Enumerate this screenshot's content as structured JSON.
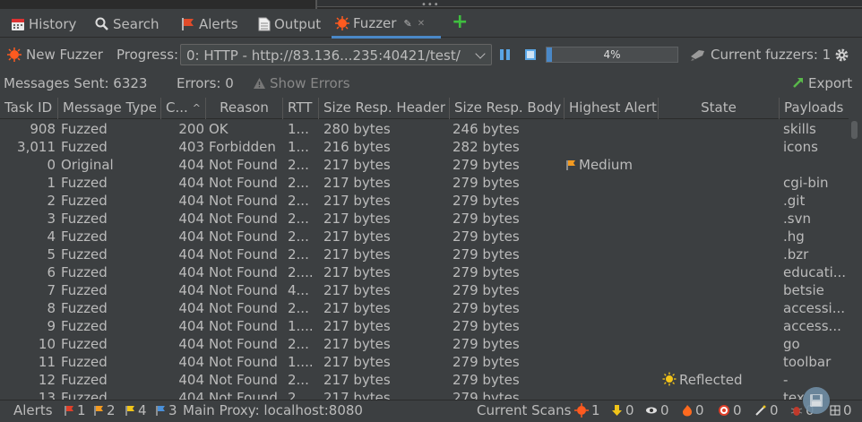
{
  "tabs": [
    {
      "label": "History",
      "icon": "history-icon"
    },
    {
      "label": "Search",
      "icon": "search-icon"
    },
    {
      "label": "Alerts",
      "icon": "alerts-flag-icon"
    },
    {
      "label": "Output",
      "icon": "output-document-icon"
    },
    {
      "label": "Fuzzer",
      "icon": "fuzzer-icon",
      "active": true
    }
  ],
  "toolbar": {
    "new_fuzzer_label": "New Fuzzer",
    "progress_label": "Progress:",
    "progress_select_value": "0: HTTP - http://83.136...235:40421/test/",
    "progress_fraction": 0.04,
    "progress_text": "4%",
    "current_fuzzers_label": "Current fuzzers: 1"
  },
  "status": {
    "messages_sent": "Messages Sent: 6323",
    "errors": "Errors: 0",
    "show_errors": "Show Errors",
    "export": "Export"
  },
  "table": {
    "columns": [
      "Task ID",
      "Message Type",
      "C...",
      "Reason",
      "RTT",
      "Size Resp. Header",
      "Size Resp. Body",
      "Highest Alert",
      "State",
      "Payloads"
    ],
    "rows": [
      {
        "id": "908",
        "type": "Fuzzed",
        "code": "200",
        "reason": "OK",
        "rtt": "1...",
        "hdr": "280 bytes",
        "body": "246 bytes",
        "alert": "",
        "state": "",
        "payload": "skills"
      },
      {
        "id": "3,011",
        "type": "Fuzzed",
        "code": "403",
        "reason": "Forbidden",
        "rtt": "1...",
        "hdr": "216 bytes",
        "body": "282 bytes",
        "alert": "",
        "state": "",
        "payload": "icons"
      },
      {
        "id": "0",
        "type": "Original",
        "code": "404",
        "reason": "Not Found",
        "rtt": "2...",
        "hdr": "217 bytes",
        "body": "279 bytes",
        "alert": "Medium",
        "state": "",
        "payload": ""
      },
      {
        "id": "1",
        "type": "Fuzzed",
        "code": "404",
        "reason": "Not Found",
        "rtt": "2...",
        "hdr": "217 bytes",
        "body": "279 bytes",
        "alert": "",
        "state": "",
        "payload": "cgi-bin"
      },
      {
        "id": "2",
        "type": "Fuzzed",
        "code": "404",
        "reason": "Not Found",
        "rtt": "2...",
        "hdr": "217 bytes",
        "body": "279 bytes",
        "alert": "",
        "state": "",
        "payload": ".git"
      },
      {
        "id": "3",
        "type": "Fuzzed",
        "code": "404",
        "reason": "Not Found",
        "rtt": "2...",
        "hdr": "217 bytes",
        "body": "279 bytes",
        "alert": "",
        "state": "",
        "payload": ".svn"
      },
      {
        "id": "4",
        "type": "Fuzzed",
        "code": "404",
        "reason": "Not Found",
        "rtt": "2...",
        "hdr": "217 bytes",
        "body": "279 bytes",
        "alert": "",
        "state": "",
        "payload": ".hg"
      },
      {
        "id": "5",
        "type": "Fuzzed",
        "code": "404",
        "reason": "Not Found",
        "rtt": "2...",
        "hdr": "217 bytes",
        "body": "279 bytes",
        "alert": "",
        "state": "",
        "payload": ".bzr"
      },
      {
        "id": "6",
        "type": "Fuzzed",
        "code": "404",
        "reason": "Not Found",
        "rtt": "2....",
        "hdr": "217 bytes",
        "body": "279 bytes",
        "alert": "",
        "state": "",
        "payload": "educati..."
      },
      {
        "id": "7",
        "type": "Fuzzed",
        "code": "404",
        "reason": "Not Found",
        "rtt": "4...",
        "hdr": "217 bytes",
        "body": "279 bytes",
        "alert": "",
        "state": "",
        "payload": "betsie"
      },
      {
        "id": "8",
        "type": "Fuzzed",
        "code": "404",
        "reason": "Not Found",
        "rtt": "2...",
        "hdr": "217 bytes",
        "body": "279 bytes",
        "alert": "",
        "state": "",
        "payload": "accessi..."
      },
      {
        "id": "9",
        "type": "Fuzzed",
        "code": "404",
        "reason": "Not Found",
        "rtt": "1....",
        "hdr": "217 bytes",
        "body": "279 bytes",
        "alert": "",
        "state": "",
        "payload": "access..."
      },
      {
        "id": "10",
        "type": "Fuzzed",
        "code": "404",
        "reason": "Not Found",
        "rtt": "2...",
        "hdr": "217 bytes",
        "body": "279 bytes",
        "alert": "",
        "state": "",
        "payload": "go"
      },
      {
        "id": "11",
        "type": "Fuzzed",
        "code": "404",
        "reason": "Not Found",
        "rtt": "1....",
        "hdr": "217 bytes",
        "body": "279 bytes",
        "alert": "",
        "state": "",
        "payload": "toolbar"
      },
      {
        "id": "12",
        "type": "Fuzzed",
        "code": "404",
        "reason": "Not Found",
        "rtt": "2...",
        "hdr": "217 bytes",
        "body": "279 bytes",
        "alert": "",
        "state": "Reflected",
        "payload": "-"
      },
      {
        "id": "13",
        "type": "Fuzzed",
        "code": "404",
        "reason": "Not Found",
        "rtt": "2...",
        "hdr": "217 bytes",
        "body": "279 bytes",
        "alert": "",
        "state": "",
        "payload": "tex..."
      }
    ]
  },
  "footer": {
    "alerts_label": "Alerts",
    "alerts_high": "1",
    "alerts_medium": "2",
    "alerts_low": "4",
    "alerts_info": "3",
    "main_proxy": "Main Proxy: localhost:8080",
    "current_scans": "Current Scans",
    "scans_active": "1",
    "scan_counts": [
      "0",
      "0",
      "0",
      "0",
      "0",
      "0",
      "0",
      "0"
    ]
  },
  "colors": {
    "accent": "#4a88c7",
    "fuzzer_orange": "#ff5a1f",
    "plus_green": "#3fbf3f",
    "export_green": "#59b84a"
  }
}
